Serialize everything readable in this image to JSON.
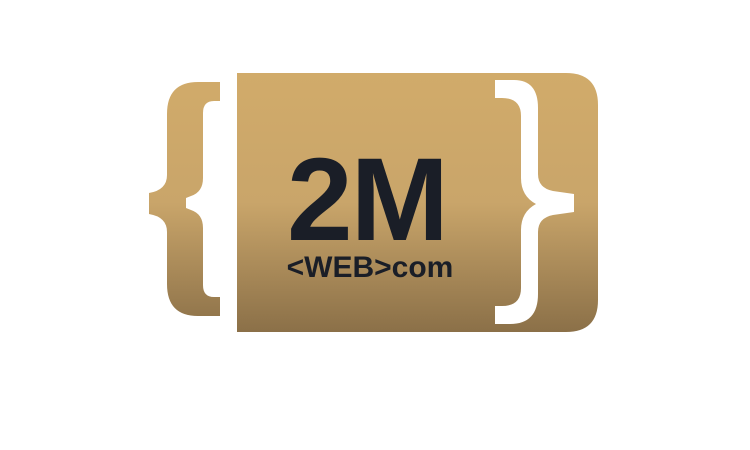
{
  "logo": {
    "main_text": "2M",
    "sub_text": "<WEB>com",
    "colors": {
      "gold_top": "#D1AB6A",
      "gold_bottom": "#8B7048",
      "text_dark": "#1A1E27",
      "background": "#FFFFFF"
    }
  }
}
